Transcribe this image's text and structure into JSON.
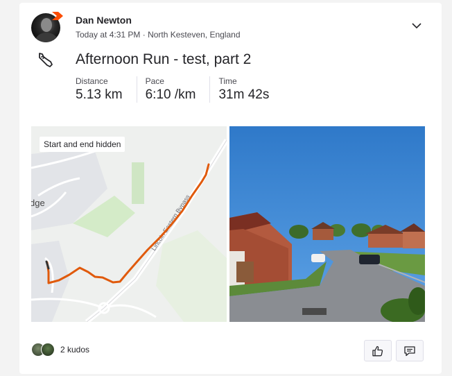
{
  "athlete": {
    "name": "Dan Newton"
  },
  "activity": {
    "timestamp": "Today at 4:31 PM",
    "location": "North Kesteven, England",
    "title": "Afternoon Run - test, part 2",
    "sport_icon": "running-shoe-icon",
    "stats": [
      {
        "label": "Distance",
        "value": "5.13 km"
      },
      {
        "label": "Pace",
        "value": "6:10 /km"
      },
      {
        "label": "Time",
        "value": "31m 42s"
      }
    ]
  },
  "map": {
    "badge": "Start and end hidden",
    "road_label": "Lincoln Eastern Bypass",
    "place_fragment": "dge",
    "route_color": "#e05a0c"
  },
  "social": {
    "kudos_text": "2 kudos",
    "kudos_icon": "thumbs-up-icon",
    "comment_icon": "comment-icon"
  },
  "colors": {
    "brand": "#fc4c02",
    "text": "#242428",
    "muted": "#494950"
  }
}
